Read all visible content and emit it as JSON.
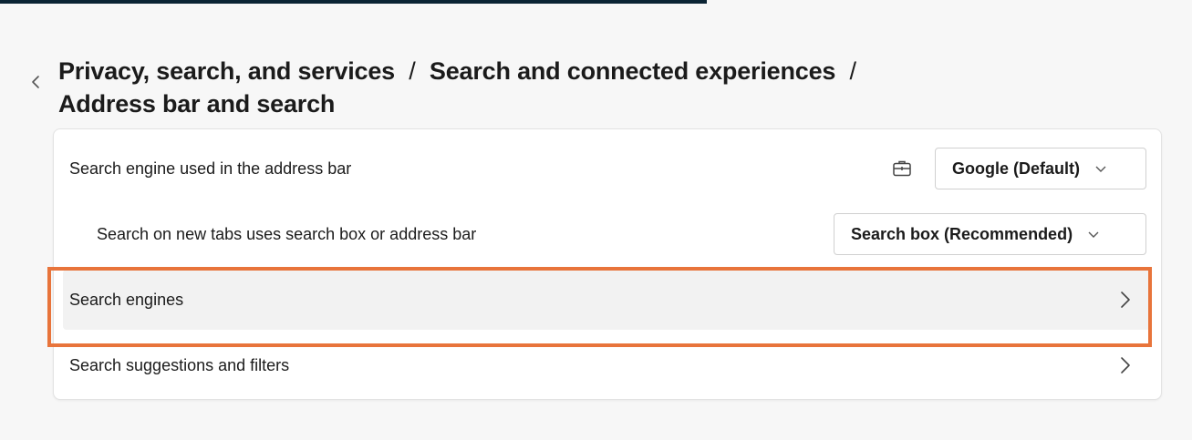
{
  "header": {
    "back_icon": "chevron-left-icon",
    "breadcrumb": [
      {
        "label": "Privacy, search, and services"
      },
      {
        "label": "Search and connected experiences"
      },
      {
        "label": "Address bar and search"
      }
    ],
    "separator": "/"
  },
  "settings": {
    "address_bar_engine": {
      "label": "Search engine used in the address bar",
      "managed_icon": "briefcase-icon",
      "selected_value": "Google (Default)"
    },
    "new_tab_search": {
      "label": "Search on new tabs uses search box or address bar",
      "selected_value": "Search box (Recommended)"
    },
    "search_engines": {
      "label": "Search engines"
    },
    "suggestions_filters": {
      "label": "Search suggestions and filters"
    }
  },
  "colors": {
    "highlight": "#e8743b",
    "top_strip": "#0b2434",
    "card_bg": "#ffffff",
    "page_bg": "#f7f7f7",
    "hover_row": "#f2f2f2"
  }
}
